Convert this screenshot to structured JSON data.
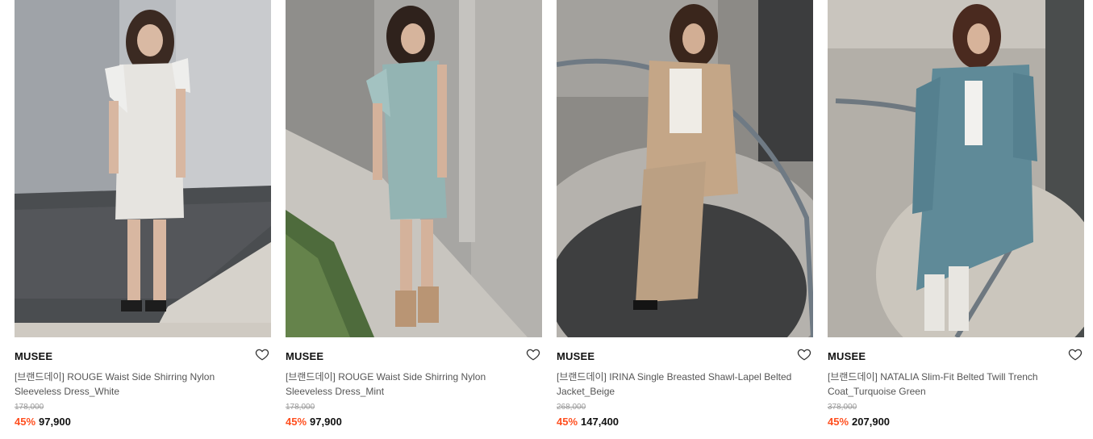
{
  "products": [
    {
      "brand": "MUSEE",
      "name": "[브랜드데이] ROUGE Waist Side Shirring Nylon Sleeveless Dress_White",
      "original_price": "178,000",
      "discount": "45%",
      "price": "97,900",
      "image_alt": "model in white sleeveless dress"
    },
    {
      "brand": "MUSEE",
      "name": "[브랜드데이] ROUGE Waist Side Shirring Nylon Sleeveless Dress_Mint",
      "original_price": "178,000",
      "discount": "45%",
      "price": "97,900",
      "image_alt": "model in mint sleeveless dress"
    },
    {
      "brand": "MUSEE",
      "name": "[브랜드데이] IRINA Single Breasted Shawl-Lapel Belted Jacket_Beige",
      "original_price": "268,000",
      "discount": "45%",
      "price": "147,400",
      "image_alt": "model in beige jacket and trousers"
    },
    {
      "brand": "MUSEE",
      "name": "[브랜드데이] NATALIA Slim-Fit Belted Twill Trench Coat_Turquoise Green",
      "original_price": "378,000",
      "discount": "45%",
      "price": "207,900",
      "image_alt": "model in turquoise trench coat"
    }
  ],
  "colors": {
    "discount": "#ff4f1f",
    "brand": "#111111",
    "name": "#555555",
    "original_price": "#9a9a9a"
  },
  "icons": {
    "wishlist": "heart-outline-icon"
  }
}
